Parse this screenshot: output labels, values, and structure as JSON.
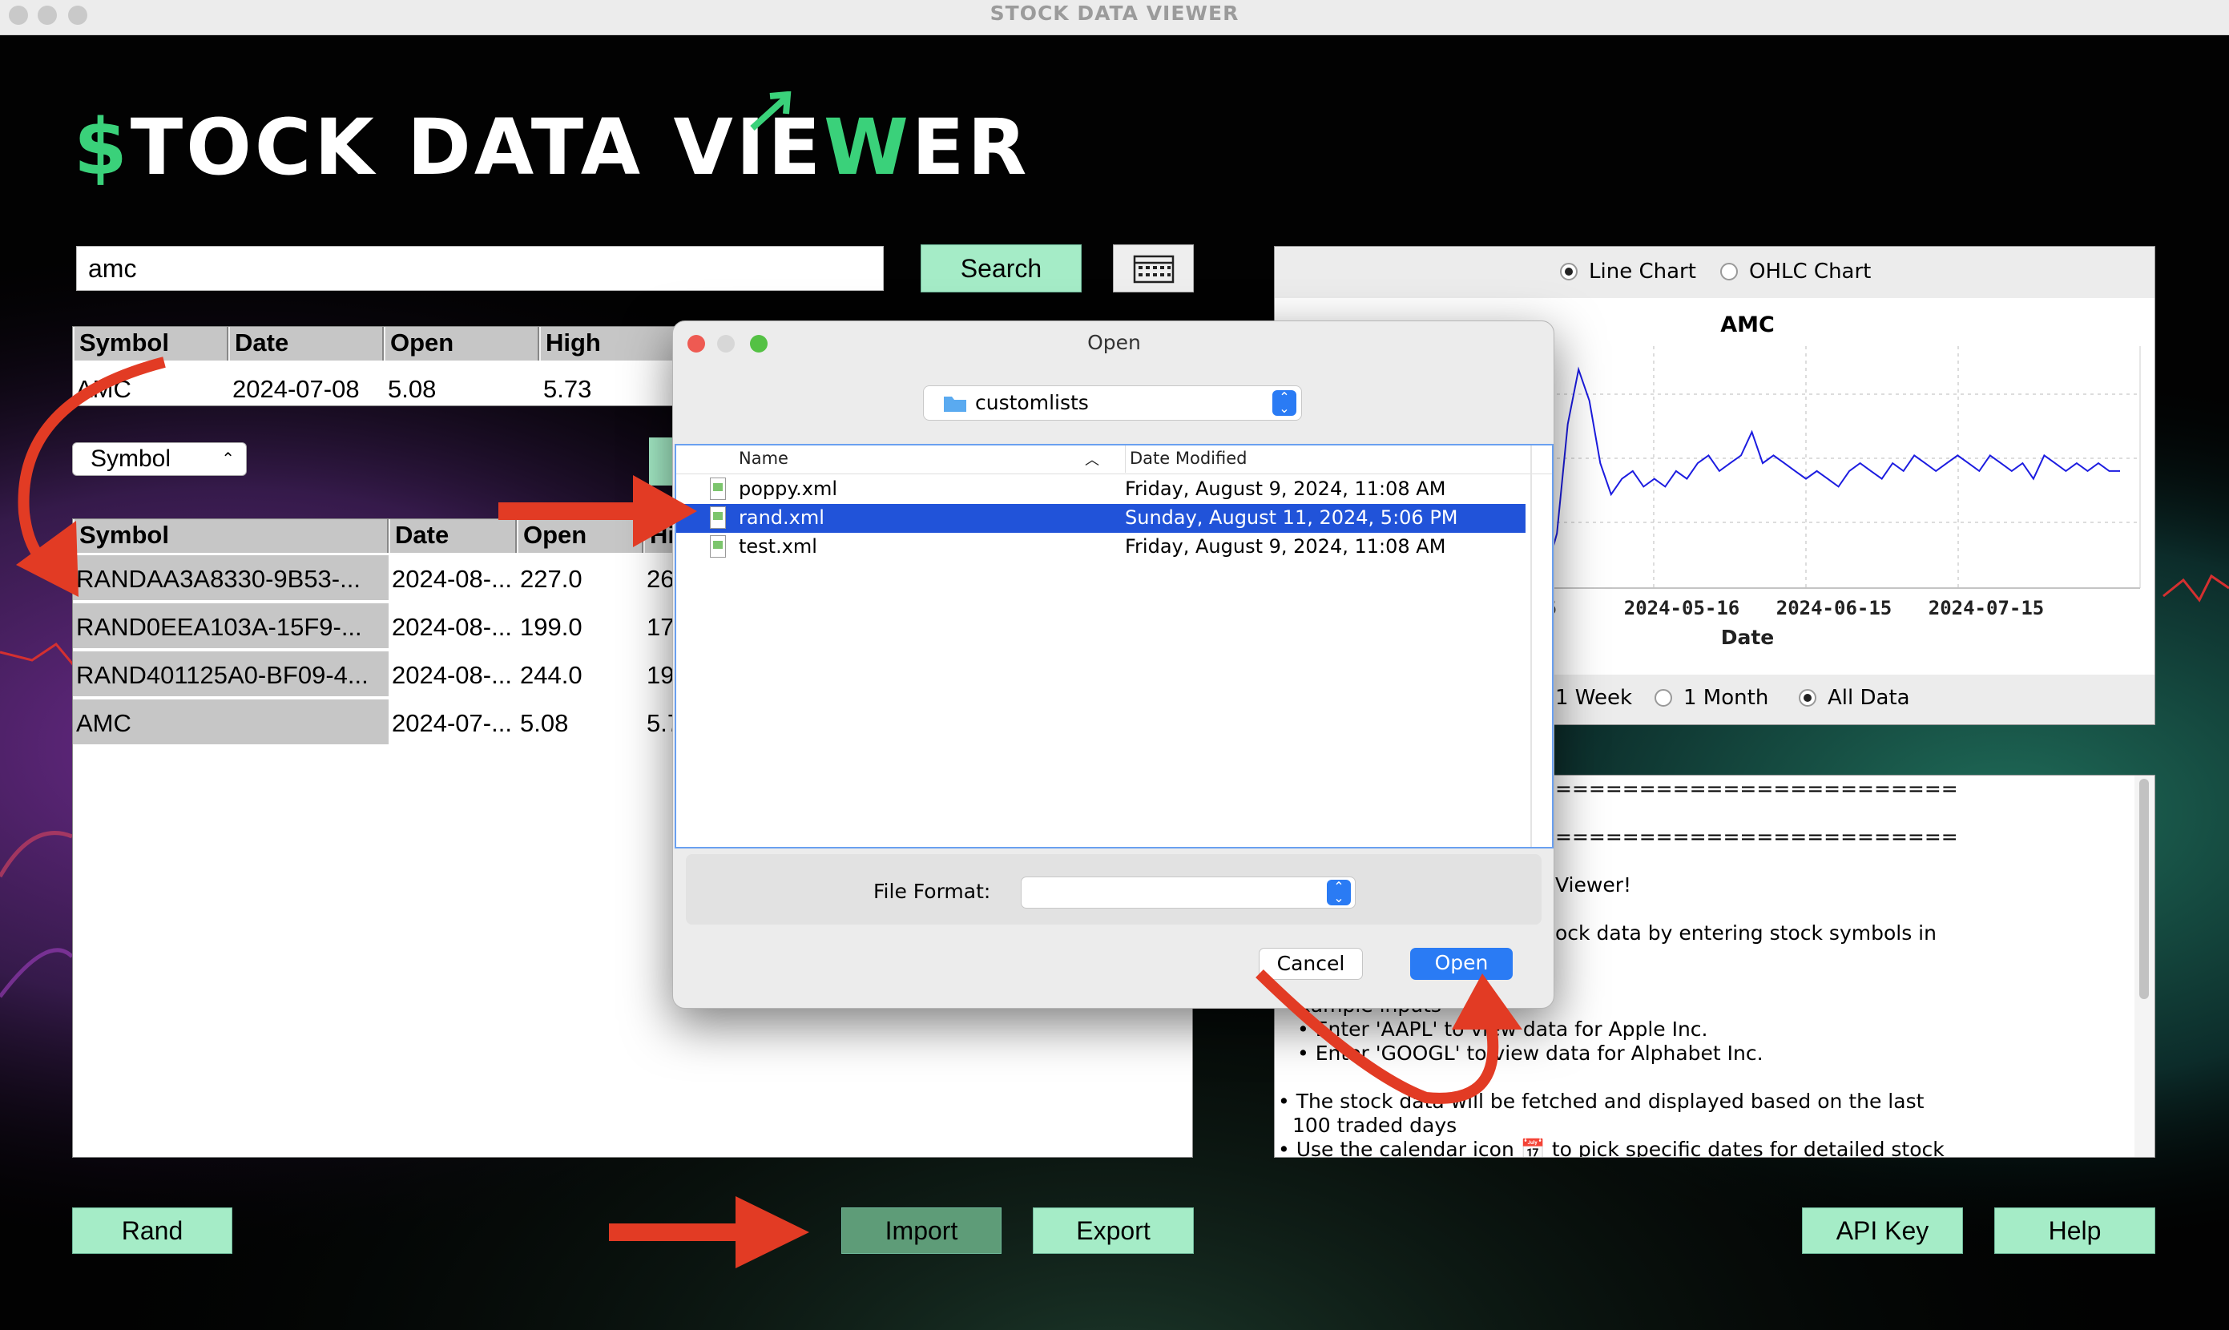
{
  "window": {
    "title": "STOCK DATA VIEWER"
  },
  "logo": {
    "pre": "$",
    "mid": "TOCK DATA VIE",
    "w": "W",
    "post": "ER"
  },
  "search": {
    "value": "amc",
    "button": "Search",
    "calendar_icon": "calendar-icon"
  },
  "top_table": {
    "headers": [
      "Symbol",
      "Date",
      "Open",
      "High"
    ],
    "row": [
      "AMC",
      "2024-07-08",
      "5.08",
      "5.73"
    ]
  },
  "symbol_select": {
    "value": "Symbol"
  },
  "list_table": {
    "headers": [
      "Symbol",
      "Date",
      "Open",
      "Hi"
    ],
    "rows": [
      [
        "RANDAA3A8330-9B53-...",
        "2024-08-...",
        "227.0",
        "26"
      ],
      [
        "RAND0EEA103A-15F9-...",
        "2024-08-...",
        "199.0",
        "17"
      ],
      [
        "RAND401125A0-BF09-4...",
        "2024-08-...",
        "244.0",
        "19"
      ],
      [
        "AMC",
        "2024-07-...",
        "5.08",
        "5.7"
      ]
    ]
  },
  "chart_panel": {
    "line_chart": "Line Chart",
    "ohlc_chart": "OHLC Chart",
    "range_1w": "1 Week",
    "range_1m": "1 Month",
    "range_all": "All Data"
  },
  "chart_data": {
    "type": "line",
    "title": "AMC",
    "xlabel": "Date",
    "ylabel": "",
    "x_ticks": [
      "-16",
      "2024-05-16",
      "2024-06-15",
      "2024-07-15"
    ],
    "series": [
      {
        "values": [
          4.6,
          4.5,
          4.7,
          4.4,
          4.6,
          4.5,
          4.6,
          4.5,
          4.4,
          4.6,
          4.5,
          4.4,
          4.9,
          6.3,
          7.0,
          6.6,
          5.8,
          5.4,
          5.6,
          5.7,
          5.5,
          5.6,
          5.5,
          5.7,
          5.6,
          5.8,
          5.9,
          5.7,
          5.8,
          5.9,
          6.2,
          5.8,
          5.9,
          5.8,
          5.7,
          5.6,
          5.7,
          5.6,
          5.5,
          5.7,
          5.8,
          5.7,
          5.6,
          5.8,
          5.7,
          5.9,
          5.8,
          5.7,
          5.8,
          5.9,
          5.8,
          5.7,
          5.9,
          5.8,
          5.7,
          5.8,
          5.6,
          5.9,
          5.8,
          5.7,
          5.8,
          5.7,
          5.8,
          5.7,
          5.7
        ]
      }
    ],
    "color": "#1c1ce0",
    "grid": true
  },
  "help": {
    "lines": [
      "========================",
      "========================",
      "Viewer!",
      "ock data by entering stock symbols in",
      "xample inputs",
      "• Enter 'AAPL' to view data for Apple Inc.",
      "• Enter 'GOOGL' to view data for Alphabet Inc.",
      "• The stock data will be fetched and displayed based on the last",
      "100 traded days",
      "• Use the calendar icon 📅 to pick specific dates for detailed stock"
    ]
  },
  "bottom": {
    "rand": "Rand",
    "import": "Import",
    "export": "Export",
    "api_key": "API Key",
    "help": "Help"
  },
  "dialog": {
    "title": "Open",
    "location": "customlists",
    "col_name": "Name",
    "col_date": "Date Modified",
    "files": [
      {
        "name": "poppy.xml",
        "date": "Friday, August 9, 2024, 11:08 AM"
      },
      {
        "name": "rand.xml",
        "date": "Sunday, August 11, 2024, 5:06 PM"
      },
      {
        "name": "test.xml",
        "date": "Friday, August 9, 2024, 11:08 AM"
      }
    ],
    "format_label": "File Format:",
    "format_value": "",
    "cancel": "Cancel",
    "open": "Open"
  },
  "colors": {
    "mint": "#a5ecc7",
    "green": "#3ad17a",
    "select_blue": "#2153d9",
    "arrow_red": "#e23b24"
  }
}
